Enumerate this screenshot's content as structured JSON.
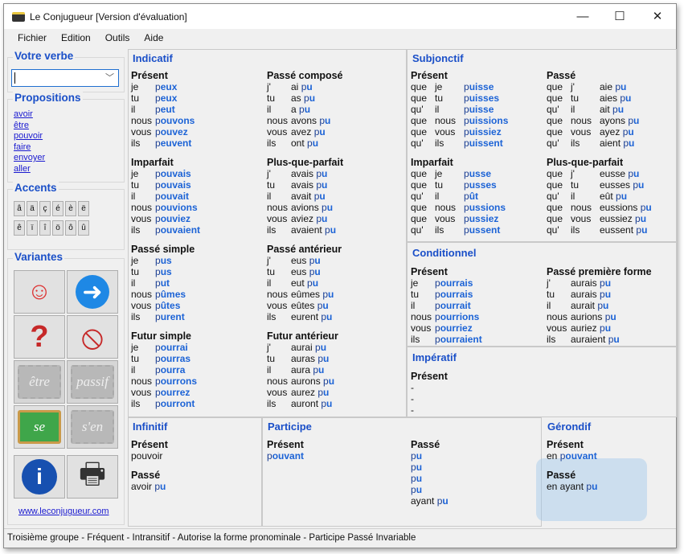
{
  "window": {
    "title": "Le Conjugueur [Version d'évaluation]",
    "minimize": "—",
    "maximize": "☐",
    "close": "✕"
  },
  "menu": [
    "Fichier",
    "Edition",
    "Outils",
    "Aide"
  ],
  "sidebar": {
    "verb_title": "Votre verbe",
    "verb_value": "",
    "prop_title": "Propositions",
    "propositions": [
      "avoir",
      "être",
      "pouvoir",
      "faire",
      "envoyer",
      "aller"
    ],
    "accents_title": "Accents",
    "accents": [
      "â",
      "ä",
      "ç",
      "é",
      "è",
      "ë",
      "ê",
      "ï",
      "î",
      "ö",
      "ô",
      "û"
    ],
    "variantes_title": "Variantes",
    "variantes": [
      {
        "icon": "girl-icon",
        "enabled": true
      },
      {
        "icon": "arrow-right-icon",
        "enabled": true
      },
      {
        "icon": "question-icon",
        "enabled": true
      },
      {
        "icon": "negation-icon",
        "enabled": true
      },
      {
        "icon": "etre-icon",
        "label": "être",
        "enabled": false
      },
      {
        "icon": "passif-icon",
        "label": "passif",
        "enabled": false
      },
      {
        "icon": "se-icon",
        "label": "se",
        "enabled": true
      },
      {
        "icon": "sen-icon",
        "label": "s'en",
        "enabled": false
      },
      {
        "icon": "info-icon",
        "enabled": true
      },
      {
        "icon": "printer-icon",
        "enabled": true
      }
    ],
    "website": "www.leconjugueur.com"
  },
  "indicatif": {
    "title": "Indicatif",
    "tenses": [
      {
        "name": "Présent",
        "forms": [
          [
            "je",
            "",
            "p",
            "eux"
          ],
          [
            "tu",
            "",
            "p",
            "eux"
          ],
          [
            "il",
            "",
            "p",
            "eut"
          ],
          [
            "nous",
            "",
            "p",
            "ouvons"
          ],
          [
            "vous",
            "",
            "p",
            "ouvez"
          ],
          [
            "ils",
            "",
            "p",
            "euvent"
          ]
        ]
      },
      {
        "name": "Passé composé",
        "forms": [
          [
            "j'",
            "ai ",
            "p",
            "u"
          ],
          [
            "tu",
            "as ",
            "p",
            "u"
          ],
          [
            "il",
            "a ",
            "p",
            "u"
          ],
          [
            "nous",
            "avons ",
            "p",
            "u"
          ],
          [
            "vous",
            "avez ",
            "p",
            "u"
          ],
          [
            "ils",
            "ont ",
            "p",
            "u"
          ]
        ]
      },
      {
        "name": "Imparfait",
        "forms": [
          [
            "je",
            "",
            "p",
            "ouvais"
          ],
          [
            "tu",
            "",
            "p",
            "ouvais"
          ],
          [
            "il",
            "",
            "p",
            "ouvait"
          ],
          [
            "nous",
            "",
            "p",
            "ouvions"
          ],
          [
            "vous",
            "",
            "p",
            "ouviez"
          ],
          [
            "ils",
            "",
            "p",
            "ouvaient"
          ]
        ]
      },
      {
        "name": "Plus-que-parfait",
        "forms": [
          [
            "j'",
            "avais ",
            "p",
            "u"
          ],
          [
            "tu",
            "avais ",
            "p",
            "u"
          ],
          [
            "il",
            "avait ",
            "p",
            "u"
          ],
          [
            "nous",
            "avions ",
            "p",
            "u"
          ],
          [
            "vous",
            "aviez ",
            "p",
            "u"
          ],
          [
            "ils",
            "avaient ",
            "p",
            "u"
          ]
        ]
      },
      {
        "name": "Passé simple",
        "forms": [
          [
            "je",
            "",
            "p",
            "us"
          ],
          [
            "tu",
            "",
            "p",
            "us"
          ],
          [
            "il",
            "",
            "p",
            "ut"
          ],
          [
            "nous",
            "",
            "p",
            "ûmes"
          ],
          [
            "vous",
            "",
            "p",
            "ûtes"
          ],
          [
            "ils",
            "",
            "p",
            "urent"
          ]
        ]
      },
      {
        "name": "Passé antérieur",
        "forms": [
          [
            "j'",
            "eus ",
            "p",
            "u"
          ],
          [
            "tu",
            "eus ",
            "p",
            "u"
          ],
          [
            "il",
            "eut ",
            "p",
            "u"
          ],
          [
            "nous",
            "eûmes ",
            "p",
            "u"
          ],
          [
            "vous",
            "eûtes ",
            "p",
            "u"
          ],
          [
            "ils",
            "eurent ",
            "p",
            "u"
          ]
        ]
      },
      {
        "name": "Futur simple",
        "forms": [
          [
            "je",
            "",
            "p",
            "ourrai"
          ],
          [
            "tu",
            "",
            "p",
            "ourras"
          ],
          [
            "il",
            "",
            "p",
            "ourra"
          ],
          [
            "nous",
            "",
            "p",
            "ourrons"
          ],
          [
            "vous",
            "",
            "p",
            "ourrez"
          ],
          [
            "ils",
            "",
            "p",
            "ourront"
          ]
        ]
      },
      {
        "name": "Futur antérieur",
        "forms": [
          [
            "j'",
            "aurai ",
            "p",
            "u"
          ],
          [
            "tu",
            "auras ",
            "p",
            "u"
          ],
          [
            "il",
            "aura ",
            "p",
            "u"
          ],
          [
            "nous",
            "aurons ",
            "p",
            "u"
          ],
          [
            "vous",
            "aurez ",
            "p",
            "u"
          ],
          [
            "ils",
            "auront ",
            "p",
            "u"
          ]
        ]
      }
    ]
  },
  "subjonctif": {
    "title": "Subjonctif",
    "tenses": [
      {
        "name": "Présent",
        "forms": [
          [
            "que",
            "je",
            "",
            "p",
            "uisse"
          ],
          [
            "que",
            "tu",
            "",
            "p",
            "uisses"
          ],
          [
            "qu'",
            "il",
            "",
            "p",
            "uisse"
          ],
          [
            "que",
            "nous",
            "",
            "p",
            "uissions"
          ],
          [
            "que",
            "vous",
            "",
            "p",
            "uissiez"
          ],
          [
            "qu'",
            "ils",
            "",
            "p",
            "uissent"
          ]
        ]
      },
      {
        "name": "Passé",
        "forms": [
          [
            "que",
            "j'",
            "aie ",
            "p",
            "u"
          ],
          [
            "que",
            "tu",
            "aies ",
            "p",
            "u"
          ],
          [
            "qu'",
            "il",
            "ait ",
            "p",
            "u"
          ],
          [
            "que",
            "nous",
            "ayons ",
            "p",
            "u"
          ],
          [
            "que",
            "vous",
            "ayez ",
            "p",
            "u"
          ],
          [
            "qu'",
            "ils",
            "aient ",
            "p",
            "u"
          ]
        ]
      },
      {
        "name": "Imparfait",
        "forms": [
          [
            "que",
            "je",
            "",
            "p",
            "usse"
          ],
          [
            "que",
            "tu",
            "",
            "p",
            "usses"
          ],
          [
            "qu'",
            "il",
            "",
            "p",
            "ût"
          ],
          [
            "que",
            "nous",
            "",
            "p",
            "ussions"
          ],
          [
            "que",
            "vous",
            "",
            "p",
            "ussiez"
          ],
          [
            "qu'",
            "ils",
            "",
            "p",
            "ussent"
          ]
        ]
      },
      {
        "name": "Plus-que-parfait",
        "forms": [
          [
            "que",
            "j'",
            "eusse ",
            "p",
            "u"
          ],
          [
            "que",
            "tu",
            "eusses ",
            "p",
            "u"
          ],
          [
            "qu'",
            "il",
            "eût ",
            "p",
            "u"
          ],
          [
            "que",
            "nous",
            "eussions ",
            "p",
            "u"
          ],
          [
            "que",
            "vous",
            "eussiez ",
            "p",
            "u"
          ],
          [
            "qu'",
            "ils",
            "eussent ",
            "p",
            "u"
          ]
        ]
      }
    ]
  },
  "conditionnel": {
    "title": "Conditionnel",
    "tenses": [
      {
        "name": "Présent",
        "forms": [
          [
            "je",
            "",
            "p",
            "ourrais"
          ],
          [
            "tu",
            "",
            "p",
            "ourrais"
          ],
          [
            "il",
            "",
            "p",
            "ourrait"
          ],
          [
            "nous",
            "",
            "p",
            "ourrions"
          ],
          [
            "vous",
            "",
            "p",
            "ourriez"
          ],
          [
            "ils",
            "",
            "p",
            "ourraient"
          ]
        ]
      },
      {
        "name": "Passé première forme",
        "forms": [
          [
            "j'",
            "aurais ",
            "p",
            "u"
          ],
          [
            "tu",
            "aurais ",
            "p",
            "u"
          ],
          [
            "il",
            "aurait ",
            "p",
            "u"
          ],
          [
            "nous",
            "aurions ",
            "p",
            "u"
          ],
          [
            "vous",
            "auriez ",
            "p",
            "u"
          ],
          [
            "ils",
            "auraient ",
            "p",
            "u"
          ]
        ]
      }
    ]
  },
  "imperatif": {
    "title": "Impératif",
    "tense": "Présent",
    "forms": [
      "-",
      "-",
      "-"
    ]
  },
  "infinitif": {
    "title": "Infinitif",
    "present_label": "Présent",
    "present": "pouvoir",
    "passe_label": "Passé",
    "passe_aux": "avoir ",
    "passe_stem": "p",
    "passe_end": "u"
  },
  "participe": {
    "title": "Participe",
    "present_label": "Présent",
    "present_stem": "p",
    "present_end": "ouvant",
    "passe_label": "Passé",
    "passe": [
      [
        "",
        "p",
        "u"
      ],
      [
        "",
        "p",
        "u"
      ],
      [
        "",
        "p",
        "u"
      ],
      [
        "",
        "p",
        "u"
      ],
      [
        "ayant ",
        "p",
        "u"
      ]
    ]
  },
  "gerondif": {
    "title": "Gérondif",
    "present_label": "Présent",
    "present_pre": "en ",
    "present_stem": "p",
    "present_end": "ouvant",
    "passe_label": "Passé",
    "passe_pre": "en ayant ",
    "passe_stem": "p",
    "passe_end": "u"
  },
  "status": "Troisième groupe - Fréquent - Intransitif - Autorise la forme pronominale - Participe Passé Invariable"
}
